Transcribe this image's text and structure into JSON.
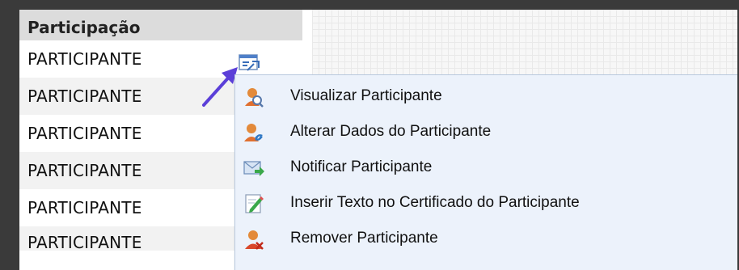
{
  "table": {
    "header": "Participação",
    "rows": [
      "PARTICIPANTE",
      "PARTICIPANTE",
      "PARTICIPANTE",
      "PARTICIPANTE",
      "PARTICIPANTE",
      "PARTICIPANTE"
    ]
  },
  "context_menu": {
    "items": [
      {
        "label": "Visualizar Participante",
        "icon": "user-search-icon"
      },
      {
        "label": "Alterar Dados do Participante",
        "icon": "user-edit-icon"
      },
      {
        "label": "Notificar Participante",
        "icon": "mail-forward-icon"
      },
      {
        "label": "Inserir Texto no Certificado do Participante",
        "icon": "document-edit-icon"
      },
      {
        "label": "Remover Participante",
        "icon": "user-remove-icon"
      }
    ]
  },
  "colors": {
    "arrow": "#5b3fd8",
    "menu_background": "#ecf2fb",
    "header_background": "#dcdcdc"
  }
}
